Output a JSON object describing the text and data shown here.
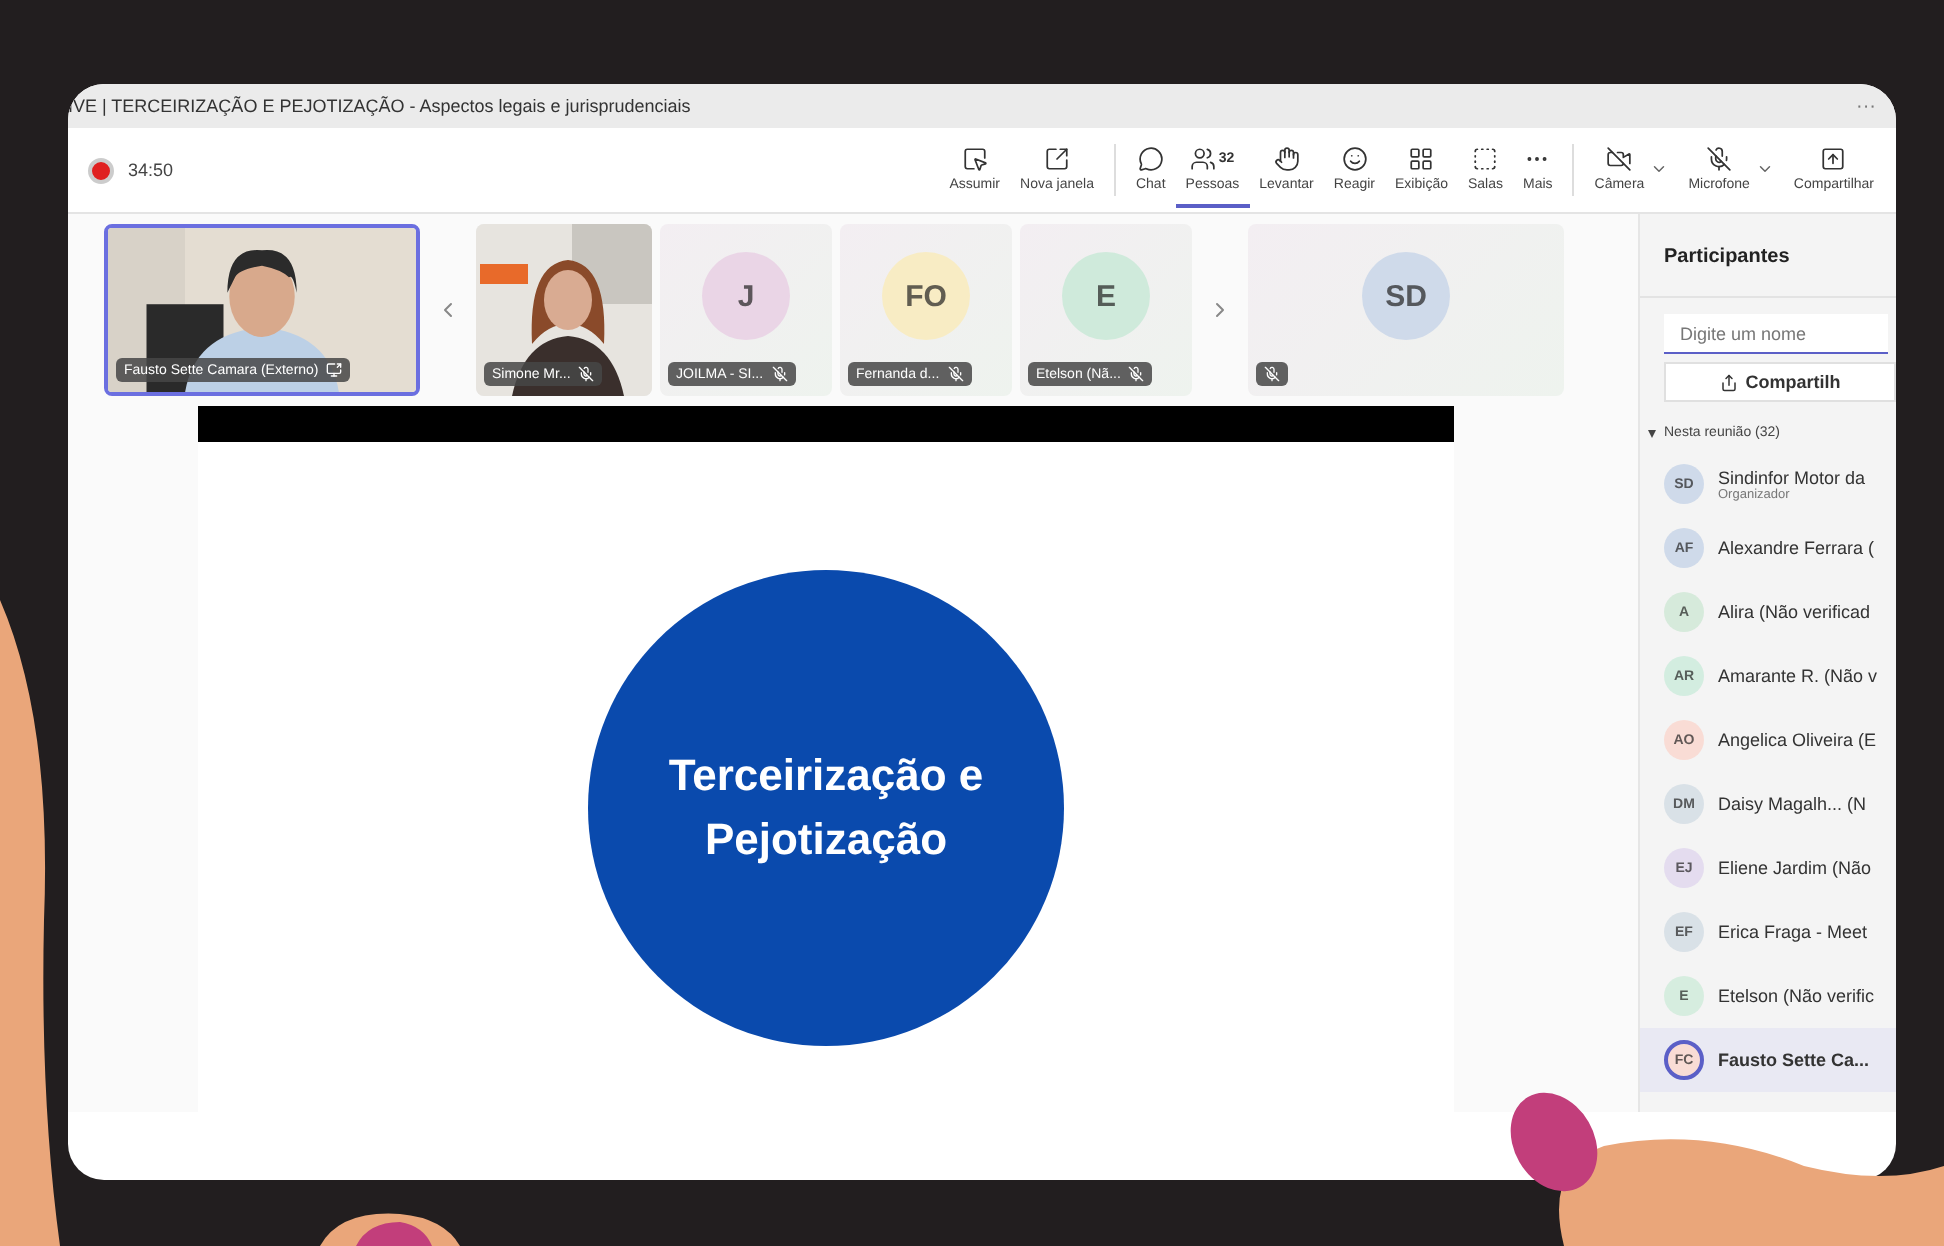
{
  "window": {
    "title": "IVE | TERCEIRIZAÇÃO E PEJOTIZAÇÃO - Aspectos legais e jurisprudenciais",
    "menu": "···"
  },
  "meeting": {
    "recording": true,
    "elapsed": "34:50"
  },
  "toolbar": [
    {
      "label": "Assumir",
      "dropdown": false,
      "selected": false
    },
    {
      "label": "Nova janela",
      "dropdown": false,
      "selected": false
    },
    {
      "label": "Chat",
      "dropdown": false,
      "selected": false
    },
    {
      "label": "Pessoas",
      "count": "32",
      "dropdown": false,
      "selected": true
    },
    {
      "label": "Levantar",
      "dropdown": false,
      "selected": false
    },
    {
      "label": "Reagir",
      "dropdown": false,
      "selected": false
    },
    {
      "label": "Exibição",
      "dropdown": false,
      "selected": false
    },
    {
      "label": "Salas",
      "dropdown": false,
      "selected": false
    },
    {
      "label": "Mais",
      "dropdown": false,
      "selected": false
    },
    {
      "label": "Câmera",
      "dropdown": true,
      "selected": false
    },
    {
      "label": "Microfone",
      "dropdown": true,
      "selected": false
    },
    {
      "label": "Compartilhar",
      "dropdown": false,
      "selected": false
    }
  ],
  "tiles": [
    {
      "kind": "video",
      "name": "Fausto Sette Camara (Externo)",
      "muted": false,
      "selected": true
    },
    {
      "kind": "prev"
    },
    {
      "kind": "video",
      "name": "Simone Mr...",
      "muted": true,
      "selected": false
    },
    {
      "kind": "avatar",
      "initials": "J",
      "name": "JOILMA - SI...",
      "muted": true,
      "color": "#ead5e6",
      "selected": false
    },
    {
      "kind": "avatar",
      "initials": "FO",
      "name": "Fernanda d...",
      "muted": true,
      "color": "#f8ecc4",
      "selected": false
    },
    {
      "kind": "avatar",
      "initials": "E",
      "name": "Etelson (Nã...",
      "muted": true,
      "color": "#cfeadb",
      "selected": false
    },
    {
      "kind": "next"
    },
    {
      "kind": "avatar",
      "initials": "SD",
      "muted": true,
      "color": "#cfdaea",
      "selected": false
    }
  ],
  "slide": {
    "title": "Terceirização e Pejotização"
  },
  "panel": {
    "title": "Participantes",
    "search": {
      "placeholder": "Digite um nome"
    },
    "share_button": "Compartilh",
    "section": {
      "label": "Nesta reunião (32)",
      "expanded": true
    },
    "participants": [
      {
        "initials": "SD",
        "name": "Sindinfor Motor da",
        "role": "Organizador",
        "color": "#cfdaea",
        "selected": false
      },
      {
        "initials": "AF",
        "name": "Alexandre Ferrara (",
        "color": "#cfdaea",
        "selected": false
      },
      {
        "initials": "A",
        "name": "Alira (Não verificad",
        "color": "#d6eadb",
        "selected": false
      },
      {
        "initials": "AR",
        "name": "Amarante R. (Não v",
        "color": "#d3ede0",
        "selected": false
      },
      {
        "initials": "AO",
        "name": "Angelica Oliveira (E",
        "color": "#f9dcd5",
        "selected": false
      },
      {
        "initials": "DM",
        "name": "Daisy Magalh... (N",
        "color": "#d9e1e7",
        "selected": false
      },
      {
        "initials": "EJ",
        "name": "Eliene Jardim (Não",
        "color": "#e4dcef",
        "selected": false
      },
      {
        "initials": "EF",
        "name": "Erica Fraga - Meet",
        "color": "#d9e1e7",
        "selected": false
      },
      {
        "initials": "E",
        "name": "Etelson (Não verific",
        "color": "#d6eddf",
        "selected": false
      },
      {
        "initials": "FC",
        "name": "Fausto Sette Ca...",
        "color": "#f9dcd5",
        "selected": true
      }
    ]
  }
}
